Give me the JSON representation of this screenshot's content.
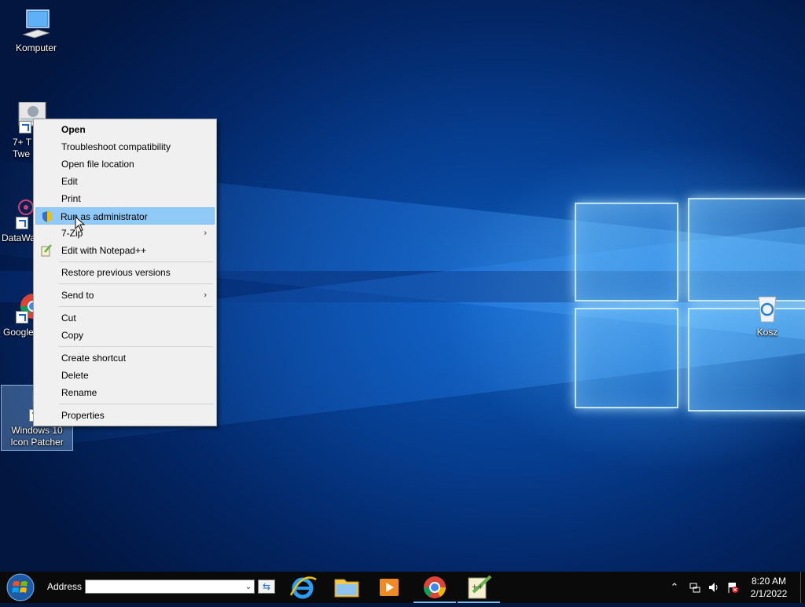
{
  "desktop": {
    "icons": [
      {
        "label": "Komputer"
      },
      {
        "label": "7+ T\nTwe"
      },
      {
        "label": "DataWa"
      },
      {
        "label": "Google"
      },
      {
        "label": "Windows 10\nIcon Patcher"
      },
      {
        "label": "Kosz"
      }
    ]
  },
  "context_menu": {
    "items": [
      {
        "label": "Open",
        "bold": true
      },
      {
        "label": "Troubleshoot compatibility"
      },
      {
        "label": "Open file location"
      },
      {
        "label": "Edit"
      },
      {
        "label": "Print"
      },
      {
        "label": "Run as administrator",
        "icon": "uac-shield-icon",
        "highlighted": true
      },
      {
        "label": "7-Zip",
        "submenu": true
      },
      {
        "label": "Edit with Notepad++",
        "icon": "notepadpp-icon"
      },
      {
        "label": "Restore previous versions"
      },
      {
        "label": "Send to",
        "submenu": true
      },
      {
        "label": "Cut"
      },
      {
        "label": "Copy"
      },
      {
        "label": "Create shortcut"
      },
      {
        "label": "Delete"
      },
      {
        "label": "Rename"
      },
      {
        "label": "Properties"
      }
    ],
    "submenu_arrow": "›"
  },
  "taskbar": {
    "address_label": "Address",
    "address_value": "",
    "apps": [
      {
        "name": "internet-explorer-icon"
      },
      {
        "name": "file-explorer-icon"
      },
      {
        "name": "media-player-icon"
      },
      {
        "name": "chrome-icon"
      },
      {
        "name": "notepadpp-icon"
      }
    ],
    "clock": {
      "time": "8:20 AM",
      "date": "2/1/2022"
    }
  },
  "colors": {
    "menu_bg": "#f0f0f0",
    "menu_highlight": "#91c9f7",
    "taskbar_bg": "#0a0a0a",
    "wallpaper_accent": "#0a58b8"
  }
}
